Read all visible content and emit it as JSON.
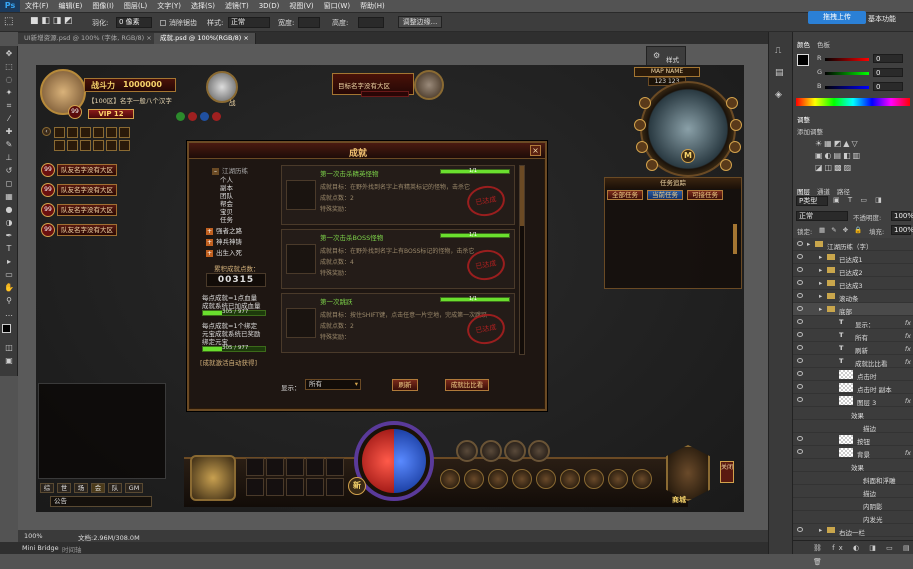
{
  "menubar": {
    "logo": "Ps",
    "items": [
      "文件(F)",
      "编辑(E)",
      "图像(I)",
      "图层(L)",
      "文字(Y)",
      "选择(S)",
      "滤镜(T)",
      "3D(D)",
      "视图(V)",
      "窗口(W)",
      "帮助(H)"
    ]
  },
  "options": {
    "feather_label": "羽化:",
    "feather_value": "0 像素",
    "anti_alias": "消除锯齿",
    "style_label": "样式:",
    "style_value": "正常",
    "width_label": "宽度:",
    "height_label": "高度:",
    "refine_button": "调整边缘..."
  },
  "upload_button": "拖拽上传",
  "workspace": "基本功能",
  "tabs": [
    "UI新增资源.psd @ 100% (字体, RGB/8) ×",
    "成就.psd @ 100%(RGB/8) ×"
  ],
  "status": {
    "zoom": "100%",
    "doc": "文档:2.96M/308.0M"
  },
  "bottom_tabs": [
    "Mini Bridge",
    "时间轴"
  ],
  "float_panel": "样式",
  "panels": {
    "color_tabs": [
      "颜色",
      "色板"
    ],
    "color_values": {
      "r": "0",
      "g": "0",
      "b": "0",
      "r_label": "R",
      "g_label": "G",
      "b_label": "B"
    },
    "adjust_tabs": [
      "调整"
    ],
    "adjust_title": "添加调整",
    "layer_tabs": [
      "图层",
      "通道",
      "路径"
    ],
    "kind": "P类型",
    "blend": "正常",
    "opacity_label": "不透明度:",
    "opacity": "100%",
    "lock_label": "锁定:",
    "fill_label": "填充:",
    "fill": "100%",
    "layers": [
      {
        "name": "江湖历练（字）",
        "type": "folder",
        "indent": 8
      },
      {
        "name": "已达成1",
        "type": "folder",
        "indent": 20
      },
      {
        "name": "已达成2",
        "type": "folder",
        "indent": 20
      },
      {
        "name": "已达成3",
        "type": "folder",
        "indent": 20
      },
      {
        "name": "滚动条",
        "type": "folder",
        "indent": 20
      },
      {
        "name": "底部",
        "type": "folder",
        "indent": 20
      },
      {
        "name": "显示：",
        "type": "text",
        "indent": 32,
        "fx": "fx"
      },
      {
        "name": "所有",
        "type": "text",
        "indent": 32,
        "fx": "fx"
      },
      {
        "name": "刷新",
        "type": "text",
        "indent": 32,
        "fx": "fx"
      },
      {
        "name": "成就比比看",
        "type": "text",
        "indent": 32,
        "fx": "fx"
      },
      {
        "name": "点击时",
        "type": "img",
        "indent": 32,
        "fx": ""
      },
      {
        "name": "点击时 副本",
        "type": "img",
        "indent": 32,
        "fx": ""
      },
      {
        "name": "图层 3",
        "type": "img",
        "indent": 32,
        "fx": "fx"
      },
      {
        "name": "效果",
        "type": "fxrow",
        "indent": 44,
        "fx": ""
      },
      {
        "name": "描边",
        "type": "fxrow",
        "indent": 56,
        "fx": ""
      },
      {
        "name": "按钮",
        "type": "img",
        "indent": 32,
        "fx": ""
      },
      {
        "name": "背景",
        "type": "img",
        "indent": 32,
        "fx": "fx"
      },
      {
        "name": "效果",
        "type": "fxrow",
        "indent": 44,
        "fx": ""
      },
      {
        "name": "斜面和浮雕",
        "type": "fxrow",
        "indent": 56,
        "fx": ""
      },
      {
        "name": "描边",
        "type": "fxrow",
        "indent": 56,
        "fx": ""
      },
      {
        "name": "内阴影",
        "type": "fxrow",
        "indent": 56,
        "fx": ""
      },
      {
        "name": "内发光",
        "type": "fxrow",
        "indent": 56,
        "fx": ""
      },
      {
        "name": "右边一栏",
        "type": "folder",
        "indent": 20
      }
    ]
  },
  "game": {
    "power_label": "战斗力",
    "power_value": "1000000",
    "player_line": "【100区】名字一般八个汉字",
    "vip": "VIP 12",
    "level": "99",
    "target_name": "目标名字没有大区",
    "pet_label": "战",
    "party": [
      "队友名字没有大区",
      "队友名字没有大区",
      "队友名字没有大区",
      "队友名字没有大区"
    ],
    "party_level": "99",
    "map_name": "MAP NAME",
    "coords": "123 123",
    "map_m": "M",
    "quest_title": "任务追踪",
    "quest_tabs": [
      "全部任务",
      "当前任务",
      "可接任务"
    ],
    "dialog_title": "成就",
    "tree": [
      "江湖历练",
      "个人",
      "副本",
      "团队",
      "帮会",
      "宝贝",
      "任务"
    ],
    "tree_groups": [
      "强者之路",
      "神兵神铸",
      "出生入死"
    ],
    "points_label": "累积成就点数：",
    "points_value": "00315",
    "reward_lines": [
      "每点成就=1点血量",
      "成就系统已加成血量"
    ],
    "bar1": "305 / 977",
    "reward_lines2": [
      "每点成就=1个绑定",
      "元宝成就系统已奖励",
      "绑定元宝"
    ],
    "bar2": "305 / 977",
    "activate": "[成就激活自动获得]",
    "achievements": [
      {
        "title": "第一次击杀精英怪物",
        "goal": "成就目标：在野外找到名字上有精英标记的怪物，击杀它",
        "points": "成就点数：2",
        "reward": "特殊奖励：",
        "stamp": "已达成",
        "progress": 1.0,
        "bar_text": "1/1"
      },
      {
        "title": "第一次击杀BOSS怪物",
        "goal": "成就目标：在野外找到名字上有BOSS标记的怪物，击杀它",
        "points": "成就点数：4",
        "reward": "特殊奖励：",
        "stamp": "已达成",
        "progress": 1.0,
        "bar_text": "1/1"
      },
      {
        "title": "第一次跳跃",
        "goal": "成就目标：按住SHIFT键，点击任意一片空地，完成第一次跳跃",
        "points": "成就点数：2",
        "reward": "特殊奖励：",
        "stamp": "已达成",
        "progress": 1.0,
        "bar_text": "1/1"
      }
    ],
    "show_label": "显示：",
    "show_value": "所有",
    "refresh": "刷新",
    "compare": "成就比比看",
    "chat_tabs": [
      "综",
      "世",
      "场",
      "会",
      "队",
      "GM"
    ],
    "chat_input": "公告",
    "new_label": "新",
    "shop": "商城",
    "bottom_nav": [
      "角色",
      "背包",
      "技能",
      "帮会",
      "好友",
      "组队",
      "排行",
      "商城",
      "系统",
      "设置"
    ],
    "side_label": "关闭"
  }
}
